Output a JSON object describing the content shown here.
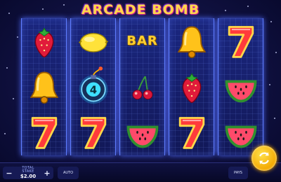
{
  "game": {
    "title": "ARCADE BOMB"
  },
  "reels": [
    [
      "strawberry",
      "bell",
      "seven"
    ],
    [
      "lemon",
      "bomb",
      "seven"
    ],
    [
      "bar",
      "cherries",
      "watermelon"
    ],
    [
      "bell",
      "strawberry",
      "seven"
    ],
    [
      "seven",
      "watermelon",
      "watermelon"
    ]
  ],
  "symbols": {
    "bar_label": "BAR",
    "bomb_count": "4"
  },
  "controls": {
    "minus_label": "−",
    "plus_label": "+",
    "stake_label": "TOTAL STAKE",
    "stake_value": "$2.00",
    "auto_label": "AUTO",
    "pays_label": "PAYS"
  },
  "colors": {
    "accent": "#ffd84a",
    "background": "#0a0b2a",
    "spin_button": "#f3a700"
  },
  "icons": {
    "spin": "spin-arrows-icon"
  }
}
